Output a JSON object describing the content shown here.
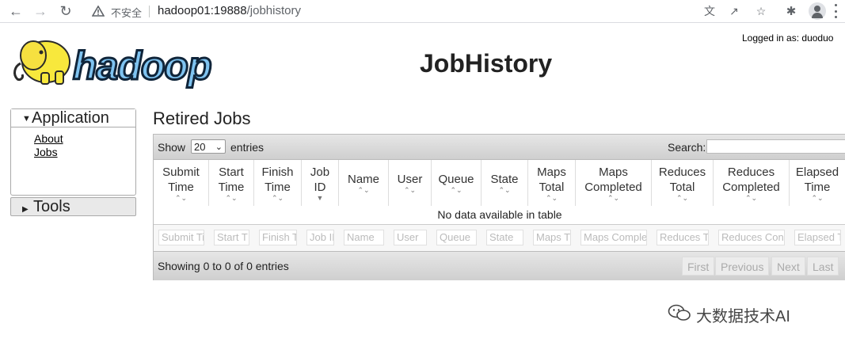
{
  "browser": {
    "security_label": "不安全",
    "url_host": "hadoop01:19888",
    "url_path": "/jobhistory"
  },
  "header": {
    "logo_text": "hadoop",
    "title": "JobHistory",
    "logged_in": "Logged in as: duoduo"
  },
  "sidebar": {
    "application": {
      "label": "Application",
      "links": [
        "About",
        "Jobs"
      ]
    },
    "tools": {
      "label": "Tools"
    }
  },
  "main": {
    "section_title": "Retired Jobs",
    "show_label": "Show",
    "page_size": "20",
    "entries_label": "entries",
    "search_label": "Search:",
    "columns": [
      "Submit\nTime",
      "Start\nTime",
      "Finish\nTime",
      "Job\nID",
      "Name",
      "User",
      "Queue",
      "State",
      "Maps\nTotal",
      "Maps\nCompleted",
      "Reduces\nTotal",
      "Reduces\nCompleted",
      "Elapsed\nTime"
    ],
    "filter_placeholders": [
      "Submit Ti",
      "Start T",
      "Finish T",
      "Job II",
      "Name",
      "User",
      "Queue",
      "State",
      "Maps T",
      "Maps Comple",
      "Reduces T",
      "Reduces Con",
      "Elapsed T"
    ],
    "empty_message": "No data available in table",
    "showing_text": "Showing 0 to 0 of 0 entries",
    "pagination": [
      "First",
      "Previous",
      "Next",
      "Last"
    ]
  },
  "watermark": {
    "text": "大数据技术AI"
  }
}
